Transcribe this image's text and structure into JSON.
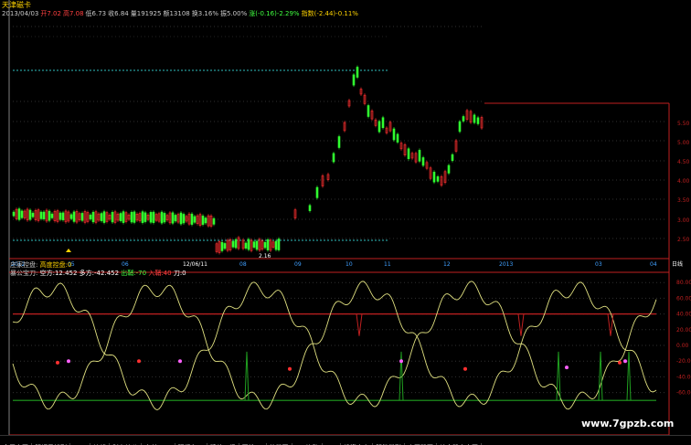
{
  "stock_name": "天津磁卡",
  "quote_line": [
    {
      "text": "2013/04/03",
      "color": "#c8c8c8"
    },
    {
      "text": "开7.02",
      "color": "#ff4040"
    },
    {
      "text": "高7.08",
      "color": "#ff4040"
    },
    {
      "text": "低6.73",
      "color": "#c8c8c8"
    },
    {
      "text": "收6.84",
      "color": "#c8c8c8"
    },
    {
      "text": "量191925",
      "color": "#c8c8c8"
    },
    {
      "text": "额13108",
      "color": "#c8c8c8"
    },
    {
      "text": "换3.16%",
      "color": "#c8c8c8"
    },
    {
      "text": "振5.00%",
      "color": "#c8c8c8"
    },
    {
      "text": "涨(-0.16)-2.29%",
      "color": "#40ff40"
    },
    {
      "text": "指数(-2.44)-0.11%",
      "color": "#ffd400"
    }
  ],
  "price_ticks": [
    "5.00",
    "4.50",
    "4.00",
    "3.50",
    "3.00",
    "2.50",
    "6.00",
    "5.50",
    "6.50"
  ],
  "date_labels": [
    "2012",
    "05",
    "06",
    "12/06/11",
    "08",
    "09",
    "10",
    "11",
    "12",
    "2013",
    "03",
    "04"
  ],
  "corner_label": "日线",
  "min_price_label": "2.16",
  "indicator_1": {
    "name": "庄家控盘:",
    "label": "高度控盘:",
    "value": "0"
  },
  "indicator_2": {
    "name": "暴公宝刀:",
    "items": [
      {
        "text": "空方:12.452",
        "color": "#ffffff"
      },
      {
        "text": "多方:-42.452",
        "color": "#ffffff"
      },
      {
        "text": "出鞘:-70",
        "color": "#40ff40"
      },
      {
        "text": "入鞘:40",
        "color": "#ff4040"
      },
      {
        "text": "刀:0",
        "color": "#ffffff"
      }
    ]
  },
  "osc_ticks": [
    "80.00",
    "60.00",
    "40.00",
    "20.00",
    "0.00",
    "-20.00",
    "-40.00",
    "-60.00"
  ],
  "tabs": [
    "全屏大图",
    "解幅风排列",
    "MA2",
    "均线",
    "财务均价",
    "大单M2X",
    "研报各五",
    "精总五报",
    "图绘01",
    "外量图",
    "KDJ均数",
    "DMI",
    "投资大力",
    "智能量形",
    "中国股票",
    "综合股市大图"
  ],
  "watermark": "www.7gpzb.com",
  "colors": {
    "up": "#ff3030",
    "down": "#30ff30",
    "curve": "#e0e080",
    "resist": "#c02020",
    "support": "#20a020",
    "axis": "#c02020"
  }
}
